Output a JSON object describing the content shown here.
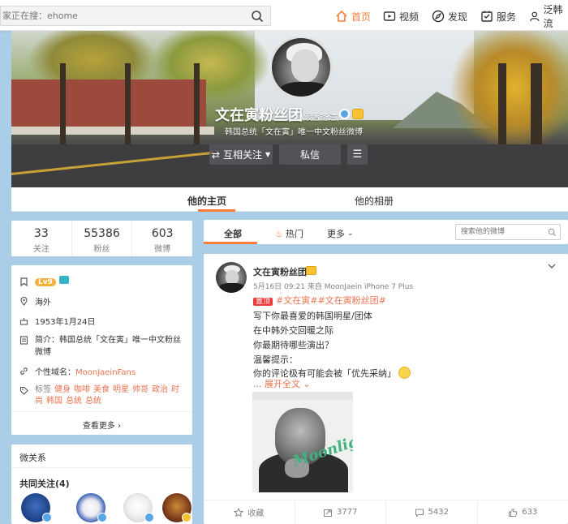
{
  "nav": {
    "search_placeholder": "家正在搜：ehome",
    "items": [
      {
        "label": "首页",
        "icon": "home-icon"
      },
      {
        "label": "视频",
        "icon": "video-icon"
      },
      {
        "label": "发现",
        "icon": "compass-icon"
      },
      {
        "label": "服务",
        "icon": "service-icon"
      },
      {
        "label": "泛韩流",
        "icon": "user-icon"
      }
    ]
  },
  "profile": {
    "name": "文在寅粉丝团",
    "remark": "(设置备注)",
    "description": "韩国总统「文在寅」唯一中文粉丝微博",
    "buttons": {
      "follow": "互相关注",
      "message": "私信"
    }
  },
  "tabs": {
    "home": "他的主页",
    "album": "他的相册"
  },
  "stats": [
    {
      "num": "33",
      "label": "关注"
    },
    {
      "num": "55386",
      "label": "粉丝"
    },
    {
      "num": "603",
      "label": "微博"
    }
  ],
  "info": {
    "level": "Lv9",
    "location": "海外",
    "birthday": "1953年1月24日",
    "intro": "简介：韩国总统「文在寅」唯一中文粉丝微博",
    "domain_label": "个性域名：",
    "domain": "MoonJaeinFans",
    "tags_label": "标签",
    "tags": [
      "健身",
      "咖啡",
      "美食",
      "明星",
      "帅哥",
      "政治",
      "时尚",
      "韩国",
      "总统",
      "总统"
    ],
    "more": "查看更多"
  },
  "relations": {
    "title": "微关系",
    "mutual": "共同关注(4)"
  },
  "feed": {
    "tabs": {
      "all": "全部",
      "hot": "热门",
      "more": "更多"
    },
    "search_placeholder": "搜索他的微博"
  },
  "post": {
    "author": "文在寅粉丝团",
    "meta": "5月16日 09:21 来自 MoonJaein iPhone 7 Plus",
    "pin": "置顶",
    "hashtags": "#文在寅##文在寅粉丝团#",
    "lines": [
      "写下你最喜爱的韩国明星/团体",
      "在中韩外交回暖之际",
      "你最期待哪些演出？",
      "温馨提示：",
      "你的评论极有可能会被「优先采纳」"
    ],
    "expand": "展开全文",
    "image_text": "Moonlight",
    "actions": {
      "favorite": "收藏",
      "repost": "3777",
      "comment": "5432",
      "like": "633"
    }
  }
}
